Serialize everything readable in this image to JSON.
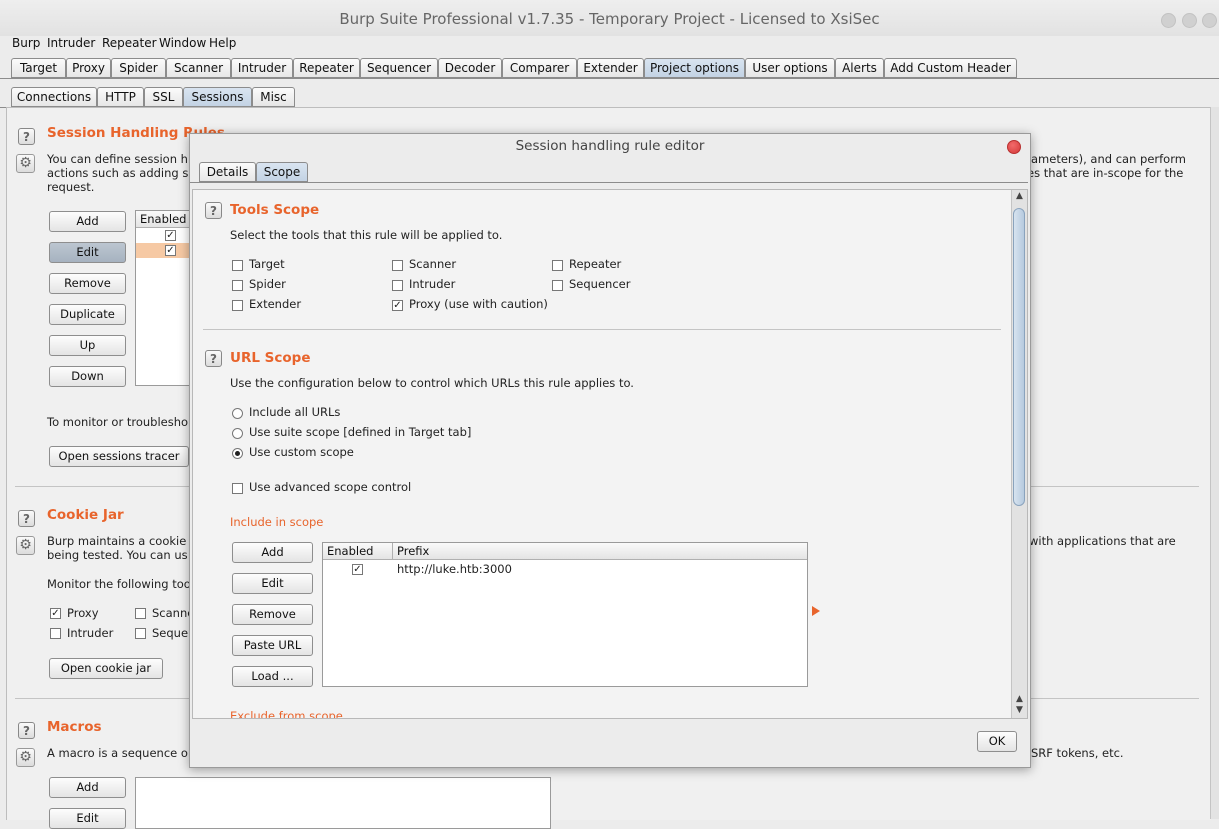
{
  "window": {
    "title": "Burp Suite Professional v1.7.35 - Temporary Project - Licensed to XsiSec"
  },
  "menu": [
    "Burp",
    "Intruder",
    "Repeater",
    "Window",
    "Help"
  ],
  "main_tabs": [
    "Target",
    "Proxy",
    "Spider",
    "Scanner",
    "Intruder",
    "Repeater",
    "Sequencer",
    "Decoder",
    "Comparer",
    "Extender",
    "Project options",
    "User options",
    "Alerts",
    "Add Custom Header"
  ],
  "main_tabs_selected": "Project options",
  "sub_tabs": [
    "Connections",
    "HTTP",
    "SSL",
    "Sessions",
    "Misc"
  ],
  "sub_tabs_selected": "Sessions",
  "session_rules": {
    "title": "Session Handling Rules",
    "desc_line1_left": "You can define session h",
    "desc_line1_right": "ameters), and can perform",
    "desc_line2_left": "actions such as adding s",
    "desc_line2_right": "es that are in-scope for the",
    "desc_line3": "request.",
    "buttons": [
      "Add",
      "Edit",
      "Remove",
      "Duplicate",
      "Up",
      "Down"
    ],
    "table_header": "Enabled",
    "rows": [
      {
        "enabled": true
      },
      {
        "enabled": true
      }
    ],
    "monitor_text": "To monitor or troublesho",
    "tracer_button": "Open sessions tracer"
  },
  "cookie_jar": {
    "title": "Cookie Jar",
    "desc_line1_left": "Burp maintains a cookie",
    "desc_line1_right": "with applications that are",
    "desc_line2": "being tested. You can us",
    "monitor_label": "Monitor the following tool",
    "tools": [
      {
        "label": "Proxy",
        "checked": true
      },
      {
        "label": "Scanne",
        "checked": false
      },
      {
        "label": "Intruder",
        "checked": false
      },
      {
        "label": "Seque",
        "checked": false
      }
    ],
    "open_button": "Open cookie jar"
  },
  "macros": {
    "title": "Macros",
    "desc_left": "A macro is a sequence o",
    "desc_right": "SRF tokens, etc.",
    "buttons": [
      "Add",
      "Edit"
    ]
  },
  "dialog": {
    "title": "Session handling rule editor",
    "tabs": [
      "Details",
      "Scope"
    ],
    "tabs_selected": "Scope",
    "tools_scope": {
      "title": "Tools Scope",
      "desc": "Select the tools that this rule will be applied to.",
      "tools": [
        {
          "label": "Target",
          "checked": false
        },
        {
          "label": "Scanner",
          "checked": false
        },
        {
          "label": "Repeater",
          "checked": false
        },
        {
          "label": "Spider",
          "checked": false
        },
        {
          "label": "Intruder",
          "checked": false
        },
        {
          "label": "Sequencer",
          "checked": false
        },
        {
          "label": "Extender",
          "checked": false
        },
        {
          "label": "Proxy (use with caution)",
          "checked": true
        }
      ]
    },
    "url_scope": {
      "title": "URL Scope",
      "desc": "Use the configuration below to control which URLs this rule applies to.",
      "options": [
        {
          "label": "Include all URLs",
          "selected": false
        },
        {
          "label": "Use suite scope [defined in Target tab]",
          "selected": false
        },
        {
          "label": "Use custom scope",
          "selected": true
        }
      ],
      "advanced_label": "Use advanced scope control",
      "advanced_checked": false,
      "include_label": "Include in scope",
      "buttons": [
        "Add",
        "Edit",
        "Remove",
        "Paste URL",
        "Load ..."
      ],
      "columns": [
        "Enabled",
        "Prefix"
      ],
      "rows": [
        {
          "enabled": true,
          "prefix": "http://luke.htb:3000"
        }
      ],
      "exclude_label": "Exclude from scope"
    },
    "ok_label": "OK"
  },
  "colors": {
    "accent": "#e8642c",
    "selected_tab": "#c3d3e4",
    "selected_row": "#f6c9a4"
  }
}
